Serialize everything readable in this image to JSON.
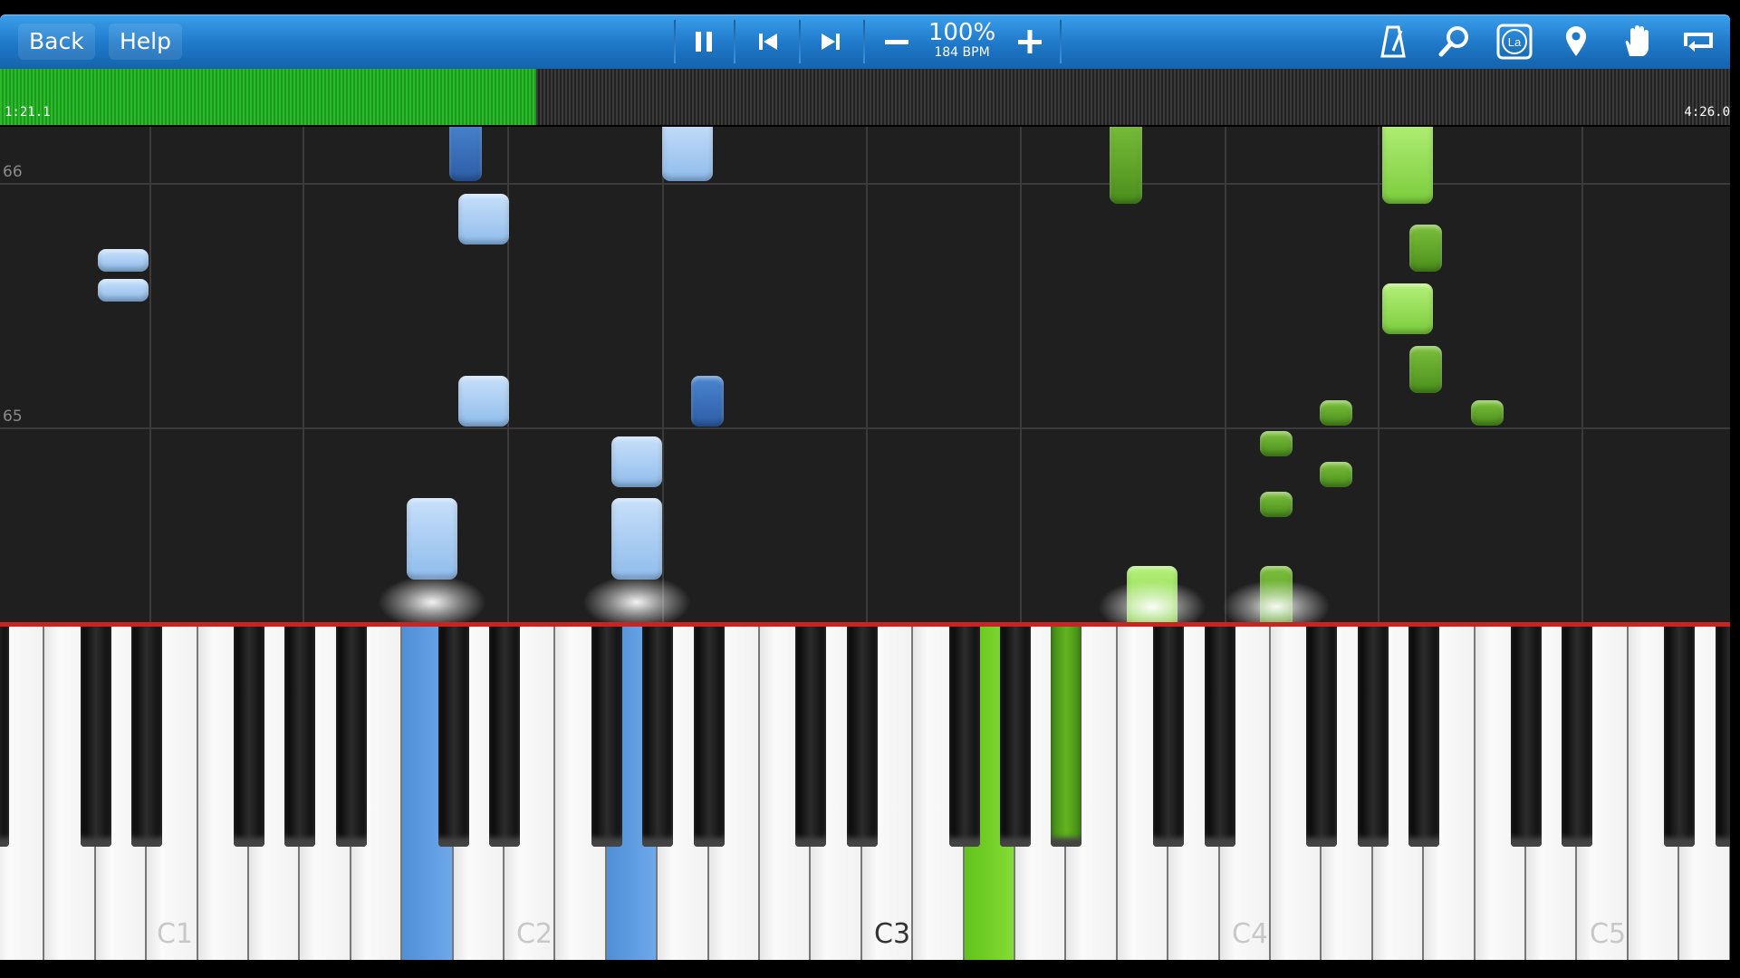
{
  "toolbar": {
    "back_label": "Back",
    "help_label": "Help",
    "speed_percent": "100%",
    "tempo": "184 BPM",
    "icons": [
      "pause-icon",
      "skip-back-icon",
      "skip-forward-icon",
      "minus-icon",
      "plus-icon",
      "metronome-icon",
      "search-icon",
      "note-label-icon",
      "location-icon",
      "hand-icon",
      "loop-icon"
    ],
    "accent": "#1f78c8"
  },
  "progress": {
    "current_time": "1:21.1",
    "total_time": "4:26.0",
    "fraction": 0.31,
    "fill_color": "#2db82d"
  },
  "roll": {
    "measure_numbers": [
      "66",
      "65"
    ],
    "left_hand_color": "#8fbcec",
    "right_hand_color": "#7bcc3c"
  },
  "keyboard": {
    "octave_labels": [
      "C1",
      "C2",
      "C3",
      "C4",
      "C5"
    ]
  }
}
